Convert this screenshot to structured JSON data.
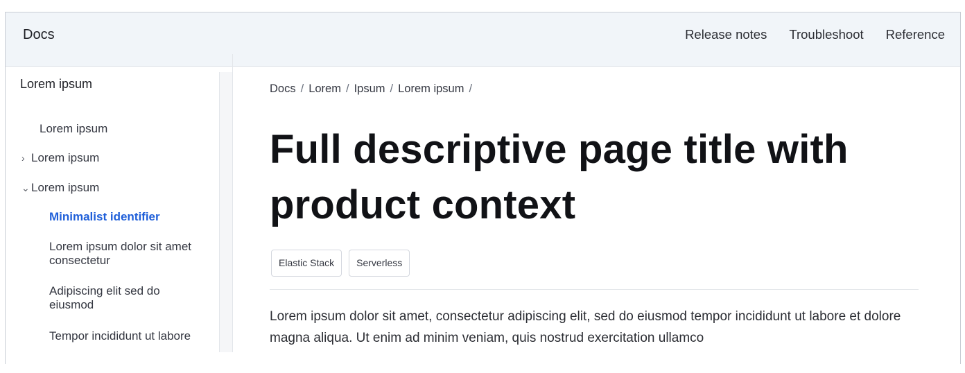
{
  "header": {
    "brand": "Docs",
    "nav": [
      "Release notes",
      "Troubleshoot",
      "Reference"
    ]
  },
  "sidebar": {
    "title": "Lorem ipsum",
    "items": [
      {
        "label": "Lorem ipsum",
        "chevron": ""
      },
      {
        "label": "Lorem ipsum",
        "chevron": "›"
      },
      {
        "label": "Lorem ipsum",
        "chevron": "⌄"
      }
    ],
    "children": [
      {
        "label": "Minimalist identifier",
        "active": true
      },
      {
        "label": "Lorem ipsum dolor sit amet consectetur",
        "active": false
      },
      {
        "label": "Adipiscing elit sed do eiusmod",
        "active": false
      },
      {
        "label": "Tempor incididunt ut labore",
        "active": false
      }
    ]
  },
  "main": {
    "breadcrumb": [
      "Docs",
      "Lorem",
      "Ipsum",
      "Lorem ipsum"
    ],
    "breadcrumb_sep": "/",
    "title": "Full descriptive page title with product context",
    "tags": [
      "Elastic Stack",
      "Serverless"
    ],
    "body": "Lorem ipsum dolor sit amet, consectetur adipiscing elit, sed do eiusmod tempor incididunt ut labore et dolore magna aliqua. Ut enim ad minim veniam, quis nostrud exercitation ullamco"
  },
  "colors": {
    "accent": "#1f5fd9",
    "topbar_bg": "#f1f5f9"
  }
}
